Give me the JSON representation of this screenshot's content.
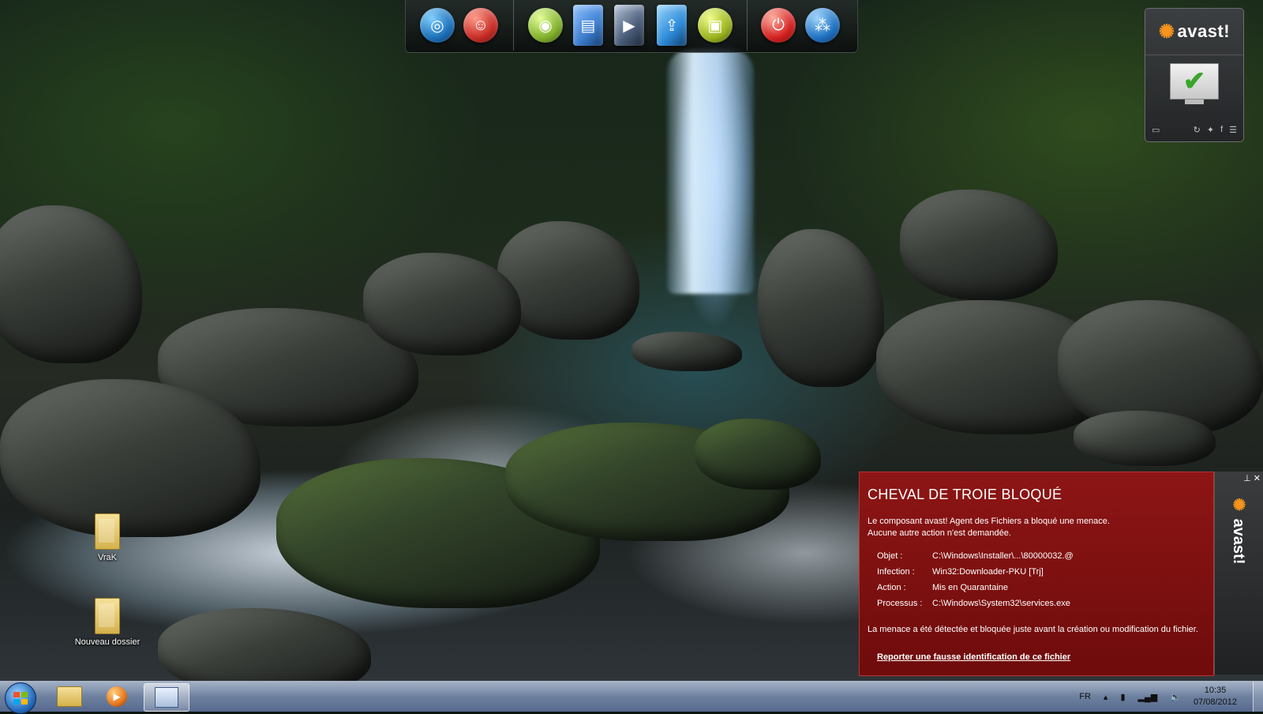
{
  "dock": {
    "icons": [
      {
        "name": "swirl-app-icon",
        "color": "#1b6fb8"
      },
      {
        "name": "red-app-icon",
        "color": "#c62a24"
      },
      {
        "name": "green-app-icon",
        "color": "#7fb02a"
      },
      {
        "name": "blue-book-icon",
        "color": "#3e7fd0"
      },
      {
        "name": "media-file-icon",
        "color": "#4a5d7a"
      },
      {
        "name": "blue-box-icon",
        "color": "#2e8bd8"
      },
      {
        "name": "lime-app-icon",
        "color": "#9ab21d"
      },
      {
        "name": "red-power-icon",
        "color": "#d21f1f"
      },
      {
        "name": "blue-network-icon",
        "color": "#1d6fbf"
      }
    ]
  },
  "gadget": {
    "brand": "avast!",
    "status": "✔"
  },
  "desktop": {
    "icons": [
      {
        "label": "VraK"
      },
      {
        "label": "Nouveau dossier"
      }
    ]
  },
  "notification": {
    "title": "CHEVAL DE TROIE BLOQUÉ",
    "message_line1": "Le composant avast! Agent des Fichiers a bloqué une menace.",
    "message_line2": "Aucune autre action n'est demandée.",
    "rows": [
      {
        "key": "Objet :",
        "value": "C:\\Windows\\Installer\\...\\80000032.@"
      },
      {
        "key": "Infection :",
        "value": "Win32:Downloader-PKU [Trj]"
      },
      {
        "key": "Action :",
        "value": "Mis en Quarantaine"
      },
      {
        "key": "Processus :",
        "value": "C:\\Windows\\System32\\services.exe"
      }
    ],
    "footer": "La menace a été détectée et bloquée juste avant la création ou modification du fichier.",
    "link": "Reporter une fausse identification de ce fichier",
    "brand": "avast!",
    "accent": "#f7941d",
    "background": "#8d1515"
  },
  "taskbar": {
    "language": "FR",
    "time": "10:35",
    "date": "07/08/2012"
  }
}
